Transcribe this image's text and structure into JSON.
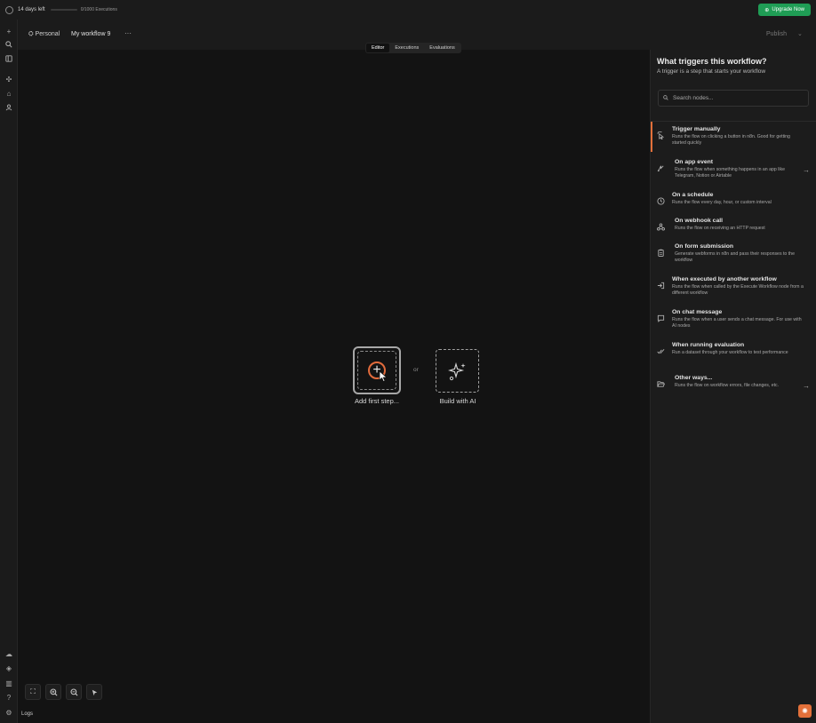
{
  "topbar": {
    "trial_text": "14 days left",
    "executions_text": "0/1000 Executions",
    "upgrade_label": "Upgrade Now"
  },
  "header": {
    "project": "Personal",
    "workflow_name": "My workflow 9",
    "more_label": "···",
    "publish_label": "Publish",
    "publish_chevron": "⌄"
  },
  "tabs": [
    {
      "label": "Editor",
      "active": true
    },
    {
      "label": "Executions",
      "active": false
    },
    {
      "label": "Evaluations",
      "active": false
    }
  ],
  "canvas": {
    "add_first_step_label": "Add first step...",
    "or_label": "or",
    "build_ai_label": "Build with AI",
    "logs_label": "Logs"
  },
  "panel": {
    "title": "What triggers this workflow?",
    "subtitle": "A trigger is a step that starts your workflow",
    "search_placeholder": "Search nodes...",
    "triggers": [
      {
        "title": "Trigger manually",
        "desc": "Runs the flow on clicking a button in n8n. Good for getting started quickly",
        "icon": "cursor-click-icon",
        "arrow": false
      },
      {
        "title": "On app event",
        "desc": "Runs the flow when something happens in an app like Telegram, Notion or Airtable",
        "icon": "app-event-icon",
        "arrow": true
      },
      {
        "title": "On a schedule",
        "desc": "Runs the flow every day, hour, or custom interval",
        "icon": "clock-icon",
        "arrow": false
      },
      {
        "title": "On webhook call",
        "desc": "Runs the flow on receiving an HTTP request",
        "icon": "webhook-icon",
        "arrow": false
      },
      {
        "title": "On form submission",
        "desc": "Generate webforms in n8n and pass their responses to the workflow",
        "icon": "clipboard-icon",
        "arrow": false
      },
      {
        "title": "When executed by another workflow",
        "desc": "Runs the flow when called by the Execute Workflow node from a different workflow",
        "icon": "sign-in-icon",
        "arrow": false
      },
      {
        "title": "On chat message",
        "desc": "Runs the flow when a user sends a chat message. For use with AI nodes",
        "icon": "chat-icon",
        "arrow": false
      },
      {
        "title": "When running evaluation",
        "desc": "Run a dataset through your workflow to test performance",
        "icon": "check-double-icon",
        "arrow": false
      },
      {
        "title": "Other ways...",
        "desc": "Runs the flow on workflow errors, file changes, etc.",
        "icon": "folder-open-icon",
        "arrow": true
      }
    ]
  },
  "colors": {
    "accent": "#e2703a",
    "upgrade": "#1f9d55",
    "canvas_bg": "#131313",
    "panel_bg": "#1c1c1c"
  }
}
